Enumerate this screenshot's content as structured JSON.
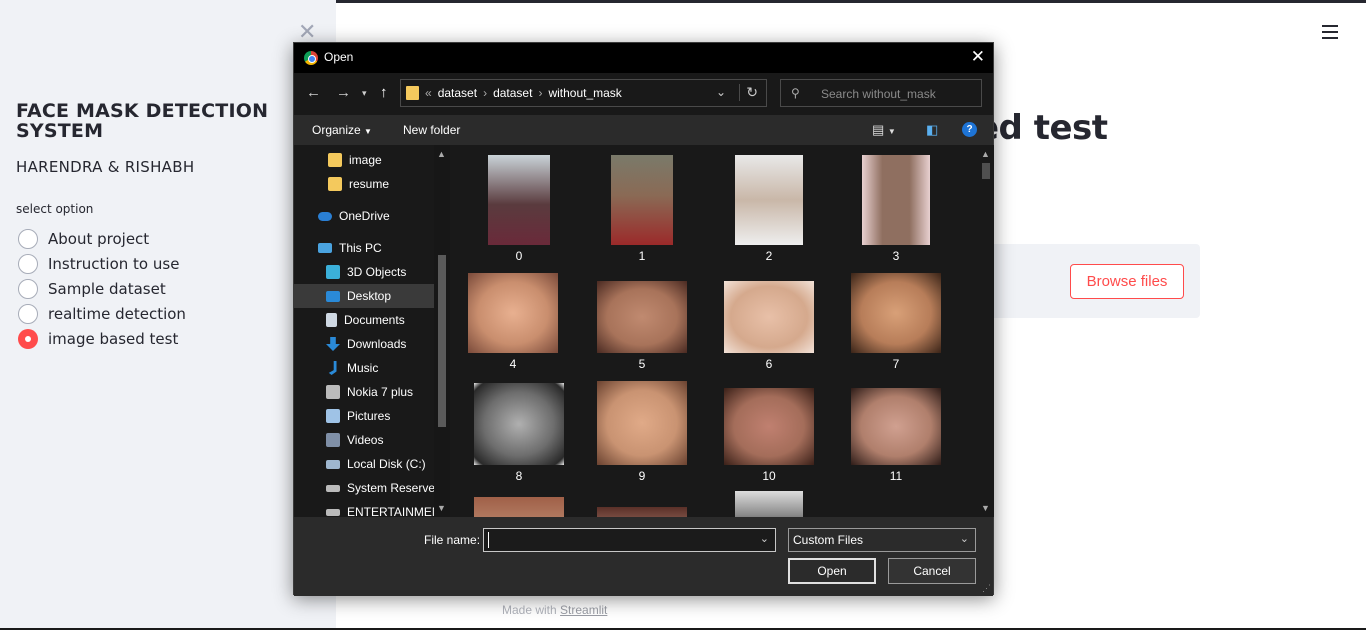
{
  "sidebar": {
    "title": "FACE MASK DETECTION SYSTEM",
    "authors": "HARENDRA & RISHABH",
    "select_label": "select option",
    "options": [
      {
        "label": "About project",
        "selected": false
      },
      {
        "label": "Instruction to use",
        "selected": false
      },
      {
        "label": "Sample dataset",
        "selected": false
      },
      {
        "label": "realtime detection",
        "selected": false
      },
      {
        "label": "image based test",
        "selected": true
      }
    ]
  },
  "main": {
    "heading_visible_fragment": "ed test",
    "browse_label": "Browse files",
    "footer_prefix": "Made with",
    "footer_link": "Streamlit"
  },
  "dialog": {
    "title": "Open",
    "path": [
      "dataset",
      "dataset",
      "without_mask"
    ],
    "search_placeholder": "Search without_mask",
    "toolbar": {
      "organize": "Organize",
      "new_folder": "New folder"
    },
    "nav_items": [
      {
        "label": "image",
        "icon": "folder-icon",
        "color": "#f4c95d"
      },
      {
        "label": "resume",
        "icon": "folder-icon",
        "color": "#f4c95d"
      },
      {
        "label": "OneDrive",
        "icon": "cloud-icon",
        "color": "#2a7fd4"
      },
      {
        "label": "This PC",
        "icon": "computer-icon",
        "color": "#4aa3df"
      },
      {
        "label": "3D Objects",
        "icon": "cube-icon",
        "color": "#3bb0d9"
      },
      {
        "label": "Desktop",
        "icon": "desktop-icon",
        "color": "#2a8ad8"
      },
      {
        "label": "Documents",
        "icon": "document-icon",
        "color": "#cfd8e3"
      },
      {
        "label": "Downloads",
        "icon": "download-icon",
        "color": "#2a8ad8"
      },
      {
        "label": "Music",
        "icon": "music-icon",
        "color": "#2a8ad8"
      },
      {
        "label": "Nokia 7 plus",
        "icon": "phone-icon",
        "color": "#bbbbbb"
      },
      {
        "label": "Pictures",
        "icon": "pictures-icon",
        "color": "#9fc3e6"
      },
      {
        "label": "Videos",
        "icon": "videos-icon",
        "color": "#7f8fa6"
      },
      {
        "label": "Local Disk (C:)",
        "icon": "drive-icon",
        "color": "#9fb7cf"
      },
      {
        "label": "System Reservec",
        "icon": "drive-icon",
        "color": "#bbbbbb"
      },
      {
        "label": "ENTERTAINMENT",
        "icon": "drive-icon",
        "color": "#bbbbbb"
      }
    ],
    "selected_nav": "Desktop",
    "files": [
      {
        "name": "0",
        "tone": "#5a3b3e"
      },
      {
        "name": "1",
        "tone": "#8a6a55"
      },
      {
        "name": "2",
        "tone": "#c9b7a8"
      },
      {
        "name": "3",
        "tone": "#8f6f60"
      },
      {
        "name": "4",
        "tone": "#c98e6e"
      },
      {
        "name": "5",
        "tone": "#a8735a"
      },
      {
        "name": "6",
        "tone": "#d5a98d"
      },
      {
        "name": "7",
        "tone": "#b77d59"
      },
      {
        "name": "8",
        "tone": "#6d6d6d"
      },
      {
        "name": "9",
        "tone": "#c99372"
      },
      {
        "name": "10",
        "tone": "#a46d5a"
      },
      {
        "name": "11",
        "tone": "#b07f6c"
      },
      {
        "name": "",
        "tone": "#c09076"
      },
      {
        "name": "",
        "tone": "#b08070"
      },
      {
        "name": "",
        "tone": "#8a8a8a"
      }
    ],
    "file_name_label": "File name:",
    "file_name_value": "",
    "file_type": "Custom Files",
    "open_label": "Open",
    "cancel_label": "Cancel"
  }
}
